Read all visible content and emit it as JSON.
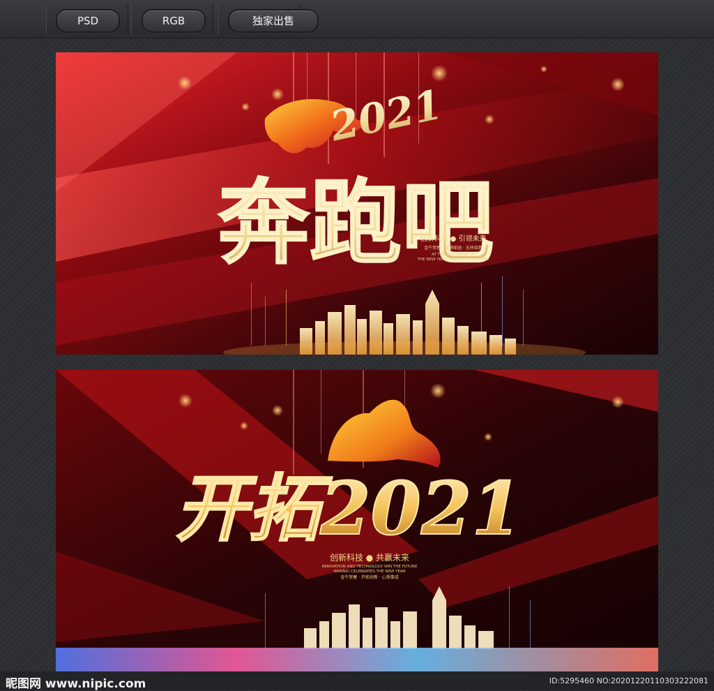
{
  "toolbar": {
    "tags": [
      "PSD",
      "RGB",
      "独家出售"
    ]
  },
  "poster1": {
    "year": "2021",
    "headline": "奔跑吧",
    "slogan": "创新科技 ● 引领未来",
    "small_line": "金牛贺春 · 福满家园 · 吉祥如意",
    "english_line1": "AT THE BEGINNING OF",
    "english_line2": "THE NEW YEAR, WANNIU IS UPDATED",
    "colors": {
      "bg": "#3a0508",
      "red": "#d01418",
      "gold": "#f3e0a2"
    }
  },
  "poster2": {
    "headline": "开拓2021",
    "slogan": "创新科技 ● 共赢未来",
    "english_line1": "INNOVATION AND TECHNOLOGY WIN THE FUTURE",
    "english_line2": "WANNIU CELEBRATES THE NEW YEAR",
    "small_line": "金牛贺春 · 开拓创新 · 心想事成",
    "colors": {
      "bg": "#2a0406",
      "red": "#c01216",
      "gold": "#f5c35a"
    }
  },
  "footer": {
    "logo": "昵图网 www.nipic.com",
    "id_text": "ID:5295460 NO:20201220110303222081"
  }
}
